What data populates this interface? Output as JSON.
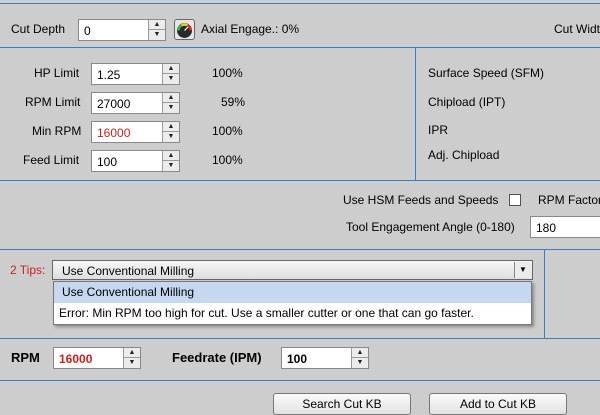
{
  "top": {
    "cut_depth_label": "Cut Depth",
    "cut_depth_value": "0",
    "axial_engage_text": "Axial Engage.: 0%",
    "cut_width_label": "Cut Widt"
  },
  "limits": [
    {
      "label": "HP Limit",
      "value": "1.25",
      "percent": "100%",
      "value_color": "#000000"
    },
    {
      "label": "RPM Limit",
      "value": "27000",
      "percent": "59%",
      "value_color": "#000000"
    },
    {
      "label": "Min RPM",
      "value": "16000",
      "percent": "100%",
      "value_color": "#cc2020"
    },
    {
      "label": "Feed Limit",
      "value": "100",
      "percent": "100%",
      "value_color": "#000000"
    }
  ],
  "right_panel": {
    "surface_speed": "Surface Speed (SFM)",
    "chipload": "Chipload (IPT)",
    "ipr": "IPR",
    "adj_chipload": "Adj. Chipload"
  },
  "options": {
    "hsm_label": "Use HSM Feeds and Speeds",
    "hsm_checked": false,
    "rpm_factor_label": "RPM Factor",
    "engagement_label": "Tool Engagement Angle (0-180)",
    "engagement_value": "180"
  },
  "tips": {
    "label": "2 Tips:",
    "selected": "Use Conventional Milling",
    "items": [
      "Use Conventional Milling",
      "Error: Min RPM too high for cut.  Use a smaller cutter or one that can go faster."
    ]
  },
  "bottom": {
    "rpm_label": "RPM",
    "rpm_value": "16000",
    "feedrate_label": "Feedrate (IPM)",
    "feedrate_value": "100",
    "search_button": "Search Cut KB",
    "add_button": "Add to Cut KB"
  },
  "colors": {
    "divider": "#3a7fc0",
    "warning_red": "#cc2020",
    "highlight": "#c5d8ef"
  },
  "icons": {
    "gauge": "gauge-icon",
    "dropdown": "chevron-down-icon"
  }
}
